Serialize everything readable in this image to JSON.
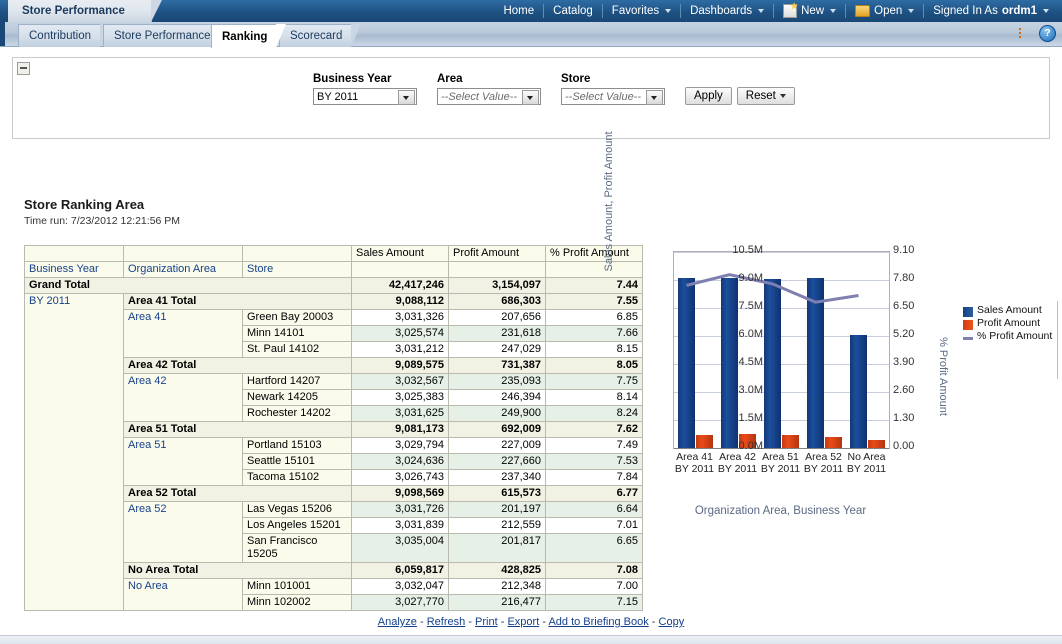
{
  "header": {
    "dashboard_title": "Store Performance",
    "nav": [
      {
        "label": "Home",
        "icon": null,
        "caret": false
      },
      {
        "label": "Catalog",
        "icon": null,
        "caret": false
      },
      {
        "label": "Favorites",
        "icon": null,
        "caret": true
      },
      {
        "label": "Dashboards",
        "icon": null,
        "caret": true
      },
      {
        "label": "New",
        "icon": "new-page-icon",
        "caret": true
      },
      {
        "label": "Open",
        "icon": "open-folder-icon",
        "caret": true
      }
    ],
    "signed_in_label": "Signed In As",
    "user": "ordm1",
    "page_options_icon": "page-options-icon",
    "help_icon": "help-icon",
    "help_glyph": "?"
  },
  "tabs": [
    {
      "label": "Contribution",
      "active": false
    },
    {
      "label": "Store Performance",
      "active": false
    },
    {
      "label": "Ranking",
      "active": true
    },
    {
      "label": "Scorecard",
      "active": false
    }
  ],
  "prompts": {
    "collapse_icon": "collapse-minus-icon",
    "fields": [
      {
        "label": "Business Year",
        "value": "BY 2011",
        "placeholder": "",
        "is_placeholder": false
      },
      {
        "label": "Area",
        "value": "--Select Value--",
        "placeholder": "--Select Value--",
        "is_placeholder": true
      },
      {
        "label": "Store",
        "value": "--Select Value--",
        "placeholder": "--Select Value--",
        "is_placeholder": true
      }
    ],
    "apply_label": "Apply",
    "reset_label": "Reset"
  },
  "report": {
    "title": "Store Ranking Area",
    "time_run": "Time run: 7/23/2012 12:21:56 PM"
  },
  "table": {
    "measure_headers": [
      "Sales Amount",
      "Profit Amount",
      "% Profit Amount"
    ],
    "dim_headers": [
      "Business Year",
      "Organization Area",
      "Store"
    ],
    "grand_total": {
      "label": "Grand Total",
      "sales": "42,417,246",
      "profit": "3,154,097",
      "pct": "7.44"
    },
    "business_year": "BY 2011",
    "groups": [
      {
        "total_label": "Area 41 Total",
        "total_sales": "9,088,112",
        "total_profit": "686,303",
        "total_pct": "7.55",
        "area_label": "Area 41",
        "stores": [
          {
            "store": "Green Bay 20003",
            "sales": "3,031,326",
            "profit": "207,656",
            "pct": "6.85",
            "shade": "white"
          },
          {
            "store": "Minn 14101",
            "sales": "3,025,574",
            "profit": "231,618",
            "pct": "7.66",
            "shade": "green"
          },
          {
            "store": "St. Paul 14102",
            "sales": "3,031,212",
            "profit": "247,029",
            "pct": "8.15",
            "shade": "white"
          }
        ]
      },
      {
        "total_label": "Area 42 Total",
        "total_sales": "9,089,575",
        "total_profit": "731,387",
        "total_pct": "8.05",
        "area_label": "Area 42",
        "stores": [
          {
            "store": "Hartford 14207",
            "sales": "3,032,567",
            "profit": "235,093",
            "pct": "7.75",
            "shade": "green"
          },
          {
            "store": "Newark 14205",
            "sales": "3,025,383",
            "profit": "246,394",
            "pct": "8.14",
            "shade": "white"
          },
          {
            "store": "Rochester 14202",
            "sales": "3,031,625",
            "profit": "249,900",
            "pct": "8.24",
            "shade": "green"
          }
        ]
      },
      {
        "total_label": "Area 51 Total",
        "total_sales": "9,081,173",
        "total_profit": "692,009",
        "total_pct": "7.62",
        "area_label": "Area 51",
        "stores": [
          {
            "store": "Portland 15103",
            "sales": "3,029,794",
            "profit": "227,009",
            "pct": "7.49",
            "shade": "white"
          },
          {
            "store": "Seattle 15101",
            "sales": "3,024,636",
            "profit": "227,660",
            "pct": "7.53",
            "shade": "green"
          },
          {
            "store": "Tacoma 15102",
            "sales": "3,026,743",
            "profit": "237,340",
            "pct": "7.84",
            "shade": "white"
          }
        ]
      },
      {
        "total_label": "Area 52 Total",
        "total_sales": "9,098,569",
        "total_profit": "615,573",
        "total_pct": "6.77",
        "area_label": "Area 52",
        "stores": [
          {
            "store": "Las Vegas 15206",
            "sales": "3,031,726",
            "profit": "201,197",
            "pct": "6.64",
            "shade": "green"
          },
          {
            "store": "Los Angeles 15201",
            "sales": "3,031,839",
            "profit": "212,559",
            "pct": "7.01",
            "shade": "white"
          },
          {
            "store": "San Francisco 15205",
            "sales": "3,035,004",
            "profit": "201,817",
            "pct": "6.65",
            "shade": "green"
          }
        ]
      },
      {
        "total_label": "No Area Total",
        "total_sales": "6,059,817",
        "total_profit": "428,825",
        "total_pct": "7.08",
        "area_label": "No Area",
        "stores": [
          {
            "store": "Minn 101001",
            "sales": "3,032,047",
            "profit": "212,348",
            "pct": "7.00",
            "shade": "white"
          },
          {
            "store": "Minn 102002",
            "sales": "3,027,770",
            "profit": "216,477",
            "pct": "7.15",
            "shade": "green"
          }
        ]
      }
    ]
  },
  "chart_data": {
    "type": "bar",
    "title": "",
    "xlabel": "Organization Area, Business Year",
    "ylabel": "Sales Amount, Profit Amount",
    "y2label": "% Profit Amount",
    "categories": [
      "Area 41 BY 2011",
      "Area 42 BY 2011",
      "Area 51 BY 2011",
      "Area 52 BY 2011",
      "No Area BY 2011"
    ],
    "ylim": [
      0,
      10500000
    ],
    "yticks": [
      "0.0M",
      "1.5M",
      "3.0M",
      "4.5M",
      "6.0M",
      "7.5M",
      "9.0M",
      "10.5M"
    ],
    "y2lim": [
      0,
      9.1
    ],
    "y2ticks": [
      "0.00",
      "1.30",
      "2.60",
      "3.90",
      "5.20",
      "6.50",
      "7.80",
      "9.10"
    ],
    "grid": true,
    "legend_position": "right",
    "series": [
      {
        "name": "Sales Amount",
        "type": "bar",
        "axis": "left",
        "color": "#1c4f9c",
        "values": [
          9088112,
          9089575,
          9081173,
          9098569,
          6059817
        ]
      },
      {
        "name": "Profit Amount",
        "type": "bar",
        "axis": "left",
        "color": "#ea4b18",
        "values": [
          686303,
          731387,
          692009,
          615573,
          428825
        ]
      },
      {
        "name": "% Profit Amount",
        "type": "line",
        "axis": "right",
        "color": "#7f7fb0",
        "values": [
          7.55,
          8.05,
          7.62,
          6.77,
          7.08
        ]
      }
    ]
  },
  "footer": {
    "links": [
      "Analyze",
      "Refresh",
      "Print",
      "Export",
      "Add to Briefing Book",
      "Copy"
    ],
    "separator": "-"
  }
}
